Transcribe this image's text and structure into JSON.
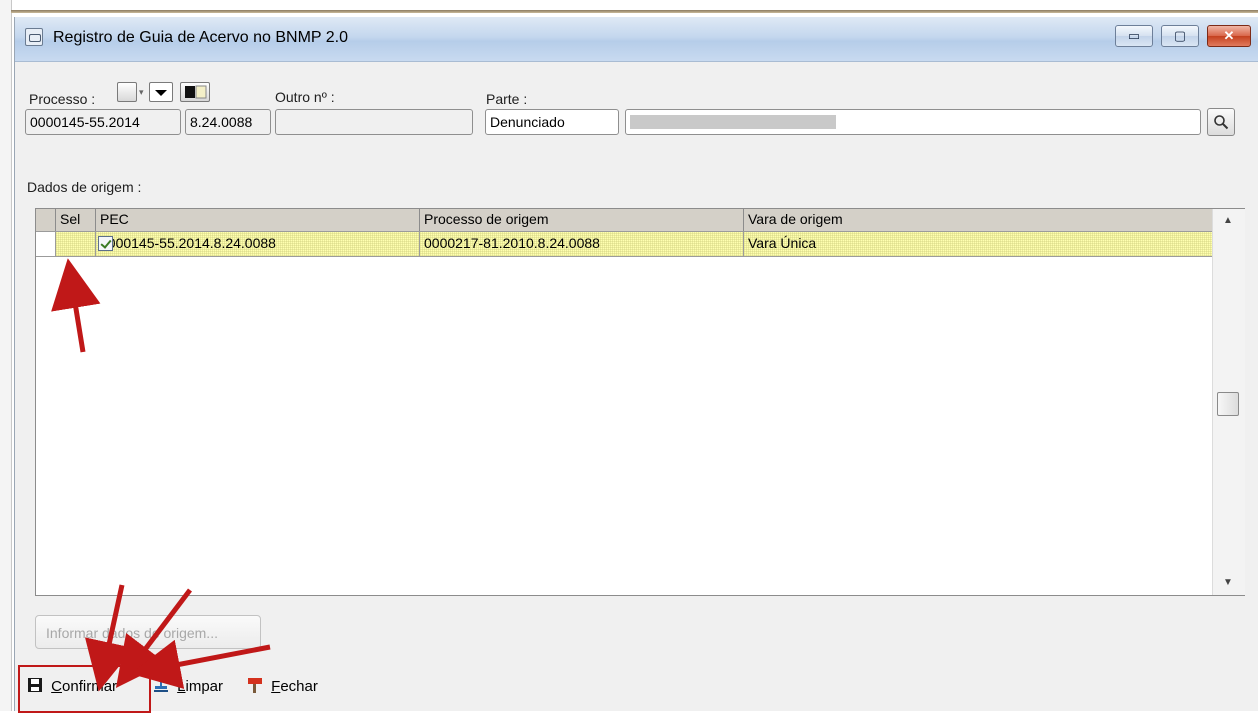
{
  "window": {
    "title": "Registro de Guia de Acervo no BNMP 2.0",
    "buttons": {
      "minimize": "▭",
      "maximize": "▢",
      "close": "✕"
    }
  },
  "form": {
    "processo_label": "Processo :",
    "processo_part1": "0000145-55.2014",
    "processo_part2": "8.24.0088",
    "outro_label": "Outro nº :",
    "outro_value": "",
    "parte_label": "Parte :",
    "parte_value": "Denunciado"
  },
  "grid": {
    "section_label": "Dados de origem :",
    "columns": [
      "Sel",
      "PEC",
      "Processo de origem",
      "Vara de origem"
    ],
    "rows": [
      {
        "selected": true,
        "pec": "0000145-55.2014.8.24.0088",
        "processo_origem": "0000217-81.2010.8.24.0088",
        "vara_origem": "Vara Única"
      }
    ]
  },
  "actions": {
    "informar_label": "Informar dados de origem...",
    "confirmar": {
      "accel": "C",
      "rest": "onfirmar"
    },
    "limpar": {
      "accel": "L",
      "rest": "impar"
    },
    "fechar": {
      "accel": "F",
      "rest": "echar"
    }
  },
  "colors": {
    "accent_annotation": "#c01818",
    "row_highlight": "#ffffb0"
  }
}
